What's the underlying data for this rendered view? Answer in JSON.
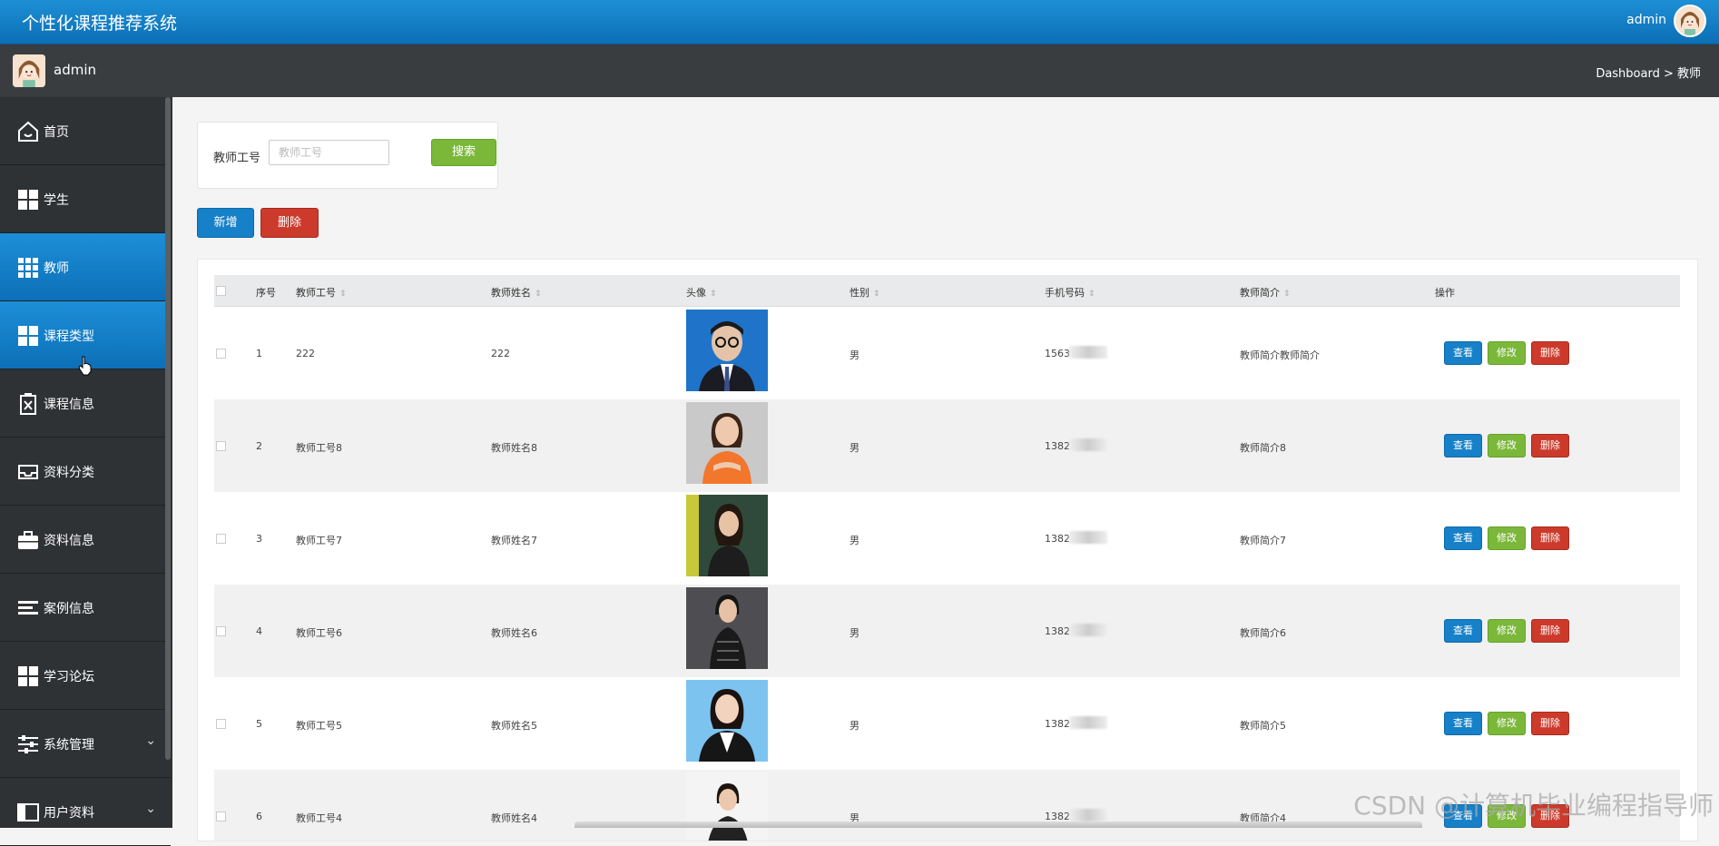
{
  "app": {
    "title": "个性化课程推荐系统",
    "user": "admin"
  },
  "header": {
    "user": "admin",
    "breadcrumb": "Dashboard > 教师"
  },
  "colors": {
    "primary": "#1680c8",
    "success": "#7bb83a",
    "danger": "#cc3a2b",
    "sidebar": "#2f3235"
  },
  "sidebar": {
    "items": [
      {
        "label": "首页",
        "icon": "home-icon"
      },
      {
        "label": "学生",
        "icon": "grid-icon"
      },
      {
        "label": "教师",
        "icon": "grid-icon",
        "active": true
      },
      {
        "label": "课程类型",
        "icon": "grid-icon",
        "active": true
      },
      {
        "label": "课程信息",
        "icon": "delete-box-icon"
      },
      {
        "label": "资料分类",
        "icon": "inbox-icon"
      },
      {
        "label": "资料信息",
        "icon": "briefcase-icon"
      },
      {
        "label": "案例信息",
        "icon": "list-icon"
      },
      {
        "label": "学习论坛",
        "icon": "grid-icon"
      },
      {
        "label": "系统管理",
        "icon": "sliders-icon",
        "chevron": "⌄"
      },
      {
        "label": "用户资料",
        "icon": "user-card-icon",
        "chevron": "⌄"
      }
    ]
  },
  "search": {
    "label": "教师工号",
    "placeholder": "教师工号",
    "value": "",
    "button": "搜索"
  },
  "toolbar": {
    "add_label": "新增",
    "delete_label": "删除"
  },
  "table": {
    "columns": [
      "序号",
      "教师工号",
      "教师姓名",
      "头像",
      "性别",
      "手机号码",
      "教师简介",
      "操作"
    ],
    "actions": {
      "view": "查看",
      "edit": "修改",
      "delete": "删除"
    },
    "rows": [
      {
        "no": "1",
        "id": "222",
        "name": "222",
        "gender": "男",
        "phone": "1563",
        "intro": "教师简介教师简介"
      },
      {
        "no": "2",
        "id": "教师工号8",
        "name": "教师姓名8",
        "gender": "男",
        "phone": "1382",
        "intro": "教师简介8"
      },
      {
        "no": "3",
        "id": "教师工号7",
        "name": "教师姓名7",
        "gender": "男",
        "phone": "1382",
        "intro": "教师简介7"
      },
      {
        "no": "4",
        "id": "教师工号6",
        "name": "教师姓名6",
        "gender": "男",
        "phone": "1382",
        "intro": "教师简介6"
      },
      {
        "no": "5",
        "id": "教师工号5",
        "name": "教师姓名5",
        "gender": "男",
        "phone": "1382",
        "intro": "教师简介5"
      },
      {
        "no": "6",
        "id": "教师工号4",
        "name": "教师姓名4",
        "gender": "男",
        "phone": "1382",
        "intro": "教师简介4"
      }
    ]
  },
  "watermark": "CSDN @计算机毕业编程指导师"
}
